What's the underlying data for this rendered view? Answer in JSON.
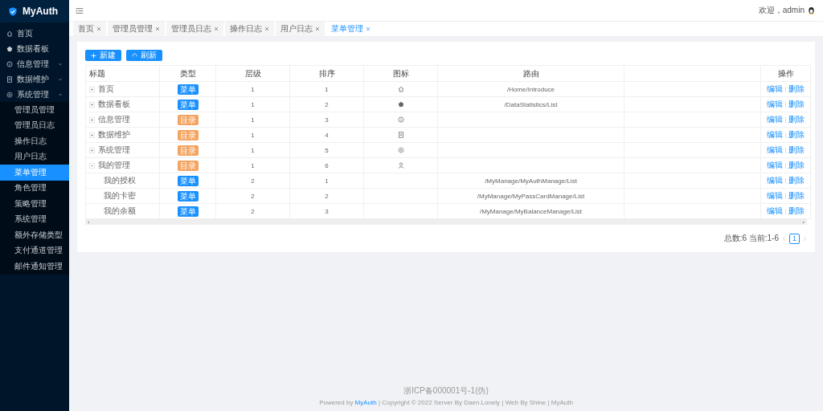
{
  "app": {
    "title": "MyAuth"
  },
  "sidebar": {
    "items": [
      {
        "label": "首页",
        "selected": false
      },
      {
        "label": "数据看板",
        "selected": false
      },
      {
        "label": "信息管理",
        "selected": false,
        "expanded": false
      },
      {
        "label": "数据维护",
        "selected": false,
        "expanded": false
      },
      {
        "label": "系统管理",
        "selected": false,
        "expanded": true,
        "children": [
          {
            "label": "管理员管理",
            "selected": false
          },
          {
            "label": "管理员日志",
            "selected": false
          },
          {
            "label": "操作日志",
            "selected": false
          },
          {
            "label": "用户日志",
            "selected": false
          },
          {
            "label": "菜单管理",
            "selected": true
          },
          {
            "label": "角色管理",
            "selected": false
          },
          {
            "label": "策略管理",
            "selected": false
          },
          {
            "label": "系统管理",
            "selected": false
          },
          {
            "label": "额外存储类型",
            "selected": false
          },
          {
            "label": "支付通道管理",
            "selected": false
          },
          {
            "label": "邮件通知管理",
            "selected": false
          }
        ]
      }
    ]
  },
  "header": {
    "welcome": "欢迎，admin"
  },
  "tabs": [
    {
      "label": "首页",
      "selected": false
    },
    {
      "label": "管理员管理",
      "selected": false
    },
    {
      "label": "管理员日志",
      "selected": false
    },
    {
      "label": "操作日志",
      "selected": false
    },
    {
      "label": "用户日志",
      "selected": false
    },
    {
      "label": "菜单管理",
      "selected": true
    }
  ],
  "toolbar": {
    "buttons": [
      {
        "label": "新建",
        "kind": "add"
      },
      {
        "label": "刷新",
        "kind": "refresh"
      }
    ]
  },
  "table": {
    "columns": [
      "标题",
      "类型",
      "层级",
      "排序",
      "图标",
      "路由",
      "操作"
    ],
    "rows": [
      {
        "title": "首页",
        "type": "菜单",
        "kind": "menu",
        "level": "1",
        "order": "1",
        "route": "/Home/Introduce",
        "expanded": false,
        "actions": [
          "编辑",
          "删除"
        ]
      },
      {
        "title": "数据看板",
        "type": "菜单",
        "kind": "menu",
        "level": "1",
        "order": "2",
        "route": "/DataStatistics/List",
        "expanded": false,
        "actions": [
          "编辑",
          "删除"
        ]
      },
      {
        "title": "信息管理",
        "type": "目录",
        "kind": "directory",
        "level": "1",
        "order": "3",
        "expanded": false,
        "actions": [
          "编辑",
          "删除"
        ]
      },
      {
        "title": "数据维护",
        "type": "目录",
        "kind": "directory",
        "level": "1",
        "order": "4",
        "expanded": false,
        "actions": [
          "编辑",
          "删除"
        ]
      },
      {
        "title": "系统管理",
        "type": "目录",
        "kind": "directory",
        "level": "1",
        "order": "5",
        "expanded": false,
        "actions": [
          "编辑",
          "删除"
        ]
      },
      {
        "title": "我的管理",
        "type": "目录",
        "kind": "directory",
        "level": "1",
        "order": "6",
        "expanded": true,
        "actions": [
          "编辑",
          "删除"
        ],
        "children": [
          {
            "title": "我的授权",
            "type": "菜单",
            "kind": "menu",
            "level": "2",
            "order": "1",
            "route": "/MyManage/MyAuthManage/List",
            "actions": [
              "编辑",
              "删除"
            ]
          },
          {
            "title": "我的卡密",
            "type": "菜单",
            "kind": "menu",
            "level": "2",
            "order": "2",
            "route": "/MyManage/MyPassCardManage/List",
            "actions": [
              "编辑",
              "删除"
            ]
          },
          {
            "title": "我的余额",
            "type": "菜单",
            "kind": "menu",
            "level": "2",
            "order": "3",
            "route": "/MyManage/MyBalanceManage/List",
            "actions": [
              "编辑",
              "删除"
            ]
          }
        ]
      }
    ]
  },
  "pagination": {
    "summary": "总数:6 当前:1-6",
    "pages": [
      {
        "label": "1",
        "selected": true
      }
    ]
  },
  "footer": {
    "icp": "浙ICP备000001号-1(伪)",
    "powered_prefix": "Powered by",
    "powered_link": "MyAuth",
    "powered_suffix": "| Copyright © 2022 Server By Daen.Lonely | Web By Shine | MyAuth"
  }
}
